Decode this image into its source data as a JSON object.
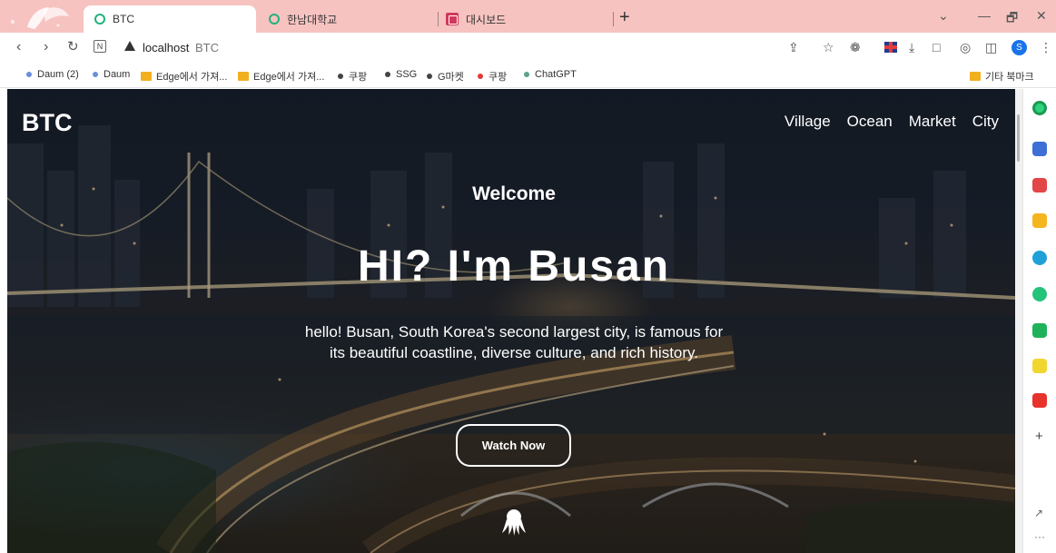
{
  "browser": {
    "tabs": [
      {
        "title": "BTC",
        "active": true
      },
      {
        "title": "한남대학교",
        "active": false
      },
      {
        "title": "대시보드",
        "active": false
      }
    ],
    "new_tab_symbol": "+",
    "window_controls": {
      "tabs_menu": "⌄",
      "minimize": "—",
      "restore": "🗗",
      "close": "✕"
    },
    "address": {
      "host": "localhost",
      "page_title": "BTC"
    },
    "profile_initial": "S"
  },
  "bookmarks": [
    {
      "label": "Daum (2)",
      "kind": "dot",
      "color": "#6a8fd8"
    },
    {
      "label": "Daum",
      "kind": "dot",
      "color": "#6a8fd8"
    },
    {
      "label": "Edge에서 가져...",
      "kind": "folder"
    },
    {
      "label": "Edge에서 가져...",
      "kind": "folder"
    },
    {
      "label": "쿠팡",
      "kind": "dot",
      "color": "#444444"
    },
    {
      "label": "SSG",
      "kind": "dot",
      "color": "#444444"
    },
    {
      "label": "G마켓",
      "kind": "dot",
      "color": "#444444"
    },
    {
      "label": "쿠팡",
      "kind": "dot",
      "color": "#e23b3b"
    },
    {
      "label": "ChatGPT",
      "kind": "dot",
      "color": "#5aa58a"
    }
  ],
  "other_bookmarks": "기타 북마크",
  "site": {
    "brand": "BTC",
    "nav": [
      "Village",
      "Ocean",
      "Market",
      "City"
    ],
    "welcome": "Welcome",
    "hero_title": "HI? I'm Busan",
    "hero_description": "hello! Busan, South Korea's second largest city, is famous for its beautiful coastline, diverse culture, and rich history.",
    "cta_label": "Watch Now"
  },
  "side_panel": {
    "add_symbol": "+",
    "more_symbol": "···"
  },
  "colors": {
    "tab_strip": "#f6c3c0",
    "accent_green": "#20b27a",
    "profile_blue": "#1a73e8"
  }
}
